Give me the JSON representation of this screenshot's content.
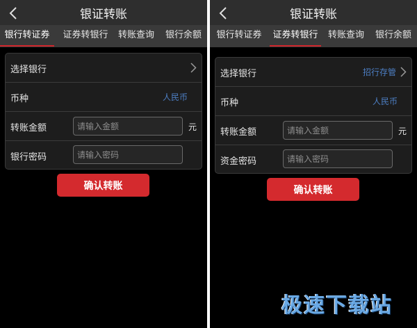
{
  "left": {
    "title": "银证转账",
    "tabs": [
      {
        "label": "银行转证券",
        "active": true
      },
      {
        "label": "证券转银行",
        "active": false
      },
      {
        "label": "转账查询",
        "active": false
      },
      {
        "label": "银行余额",
        "active": false
      }
    ],
    "rows": {
      "bank": {
        "label": "选择银行",
        "value": ""
      },
      "currency": {
        "label": "币种",
        "value": "人民币"
      },
      "amount": {
        "label": "转账金额",
        "placeholder": "请输入金额",
        "unit": "元"
      },
      "password": {
        "label": "银行密码",
        "placeholder": "请输入密码"
      }
    },
    "confirm_label": "确认转账"
  },
  "right": {
    "title": "银证转账",
    "tabs": [
      {
        "label": "银行转证券",
        "active": false
      },
      {
        "label": "证券转银行",
        "active": true
      },
      {
        "label": "转账查询",
        "active": false
      },
      {
        "label": "银行余额",
        "active": false
      }
    ],
    "rows": {
      "bank": {
        "label": "选择银行",
        "value": "招行存管"
      },
      "currency": {
        "label": "币种",
        "value": "人民币"
      },
      "amount": {
        "label": "转账金额",
        "placeholder": "请输入金额",
        "unit": "元"
      },
      "password": {
        "label": "资金密码",
        "placeholder": "请输入密码"
      }
    },
    "confirm_label": "确认转账"
  },
  "watermark": "极速下载站",
  "colors": {
    "background": "#000000",
    "topbar": "#2e2e2e",
    "tabbar": "#3a3a3a",
    "accent_red": "#d42a2e",
    "value_blue": "#4d7fc4"
  },
  "icons": {
    "back": "chevron-left-icon",
    "row_arrow": "chevron-right-icon"
  }
}
